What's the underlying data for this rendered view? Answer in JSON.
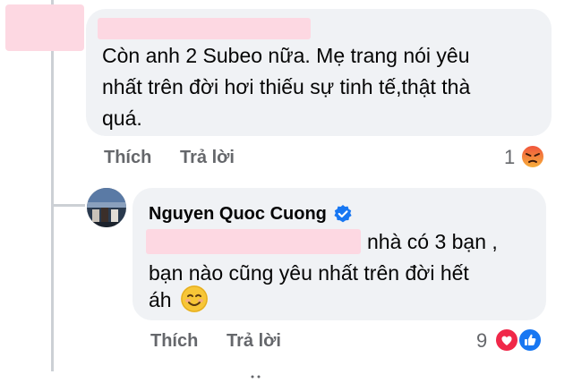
{
  "first_comment": {
    "text_line1": "Còn anh 2 Subeo nữa. Mẹ trang nói yêu",
    "text_line2": "nhất trên đời hơi thiếu sự tinh tế,thật thà",
    "text_line3": "quá.",
    "like_label": "Thích",
    "reply_label": "Trả lời",
    "reaction_count": "1",
    "reaction_icon": "angry-reaction-icon"
  },
  "reply_comment": {
    "author": "Nguyen Quoc Cuong",
    "verified_icon": "verified-badge-icon",
    "text_line1": "nhà có 3 bạn ,",
    "text_line2": "bạn nào cũng yêu nhất trên đời hết",
    "text_line3": "áh",
    "emoji": "smiling-face-icon",
    "like_label": "Thích",
    "reply_label": "Trả lời",
    "reaction_count": "9",
    "reaction_icons": [
      "love-reaction-icon",
      "like-reaction-icon"
    ]
  },
  "colors": {
    "bubble": "#f0f2f5",
    "redaction": "#fdd8e2",
    "secondary_text": "#65676b",
    "verified_blue": "#1877f2"
  }
}
